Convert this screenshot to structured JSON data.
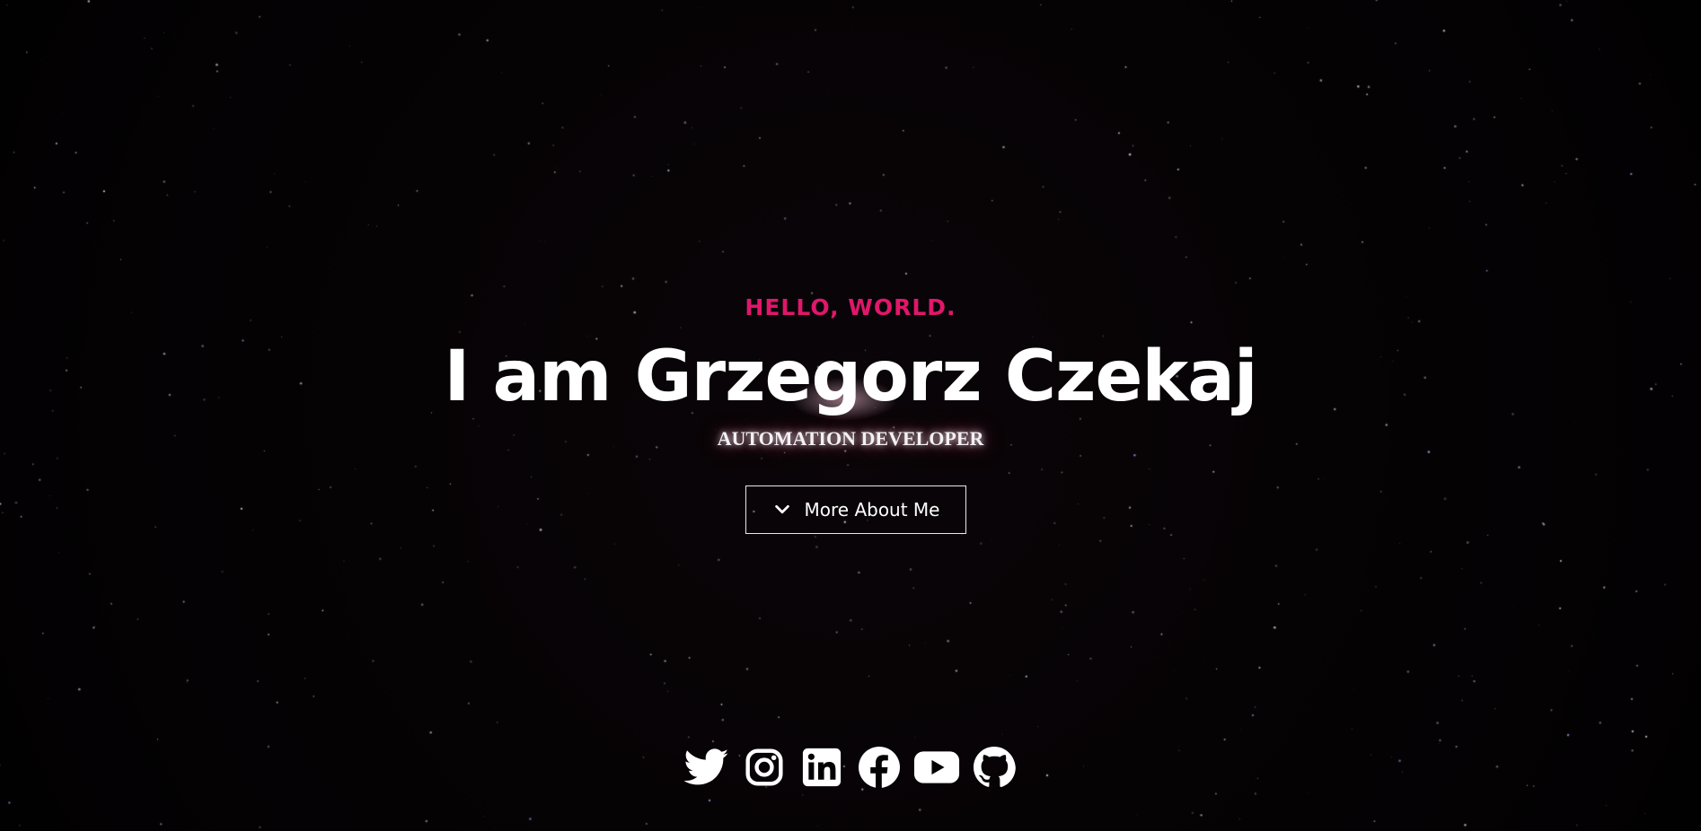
{
  "hero": {
    "greeting": "HELLO, WORLD.",
    "name": "I am Grzegorz Czekaj",
    "role": "AUTOMATION DEVELOPER",
    "cta_label": "More About Me",
    "cta_icon": "chevron-down-icon"
  },
  "social": [
    {
      "icon": "twitter-icon"
    },
    {
      "icon": "instagram-icon"
    },
    {
      "icon": "linkedin-icon"
    },
    {
      "icon": "facebook-icon"
    },
    {
      "icon": "youtube-icon"
    },
    {
      "icon": "github-icon"
    }
  ],
  "colors": {
    "background": "#040204",
    "accent": "#e0176b",
    "text": "#ffffff"
  }
}
